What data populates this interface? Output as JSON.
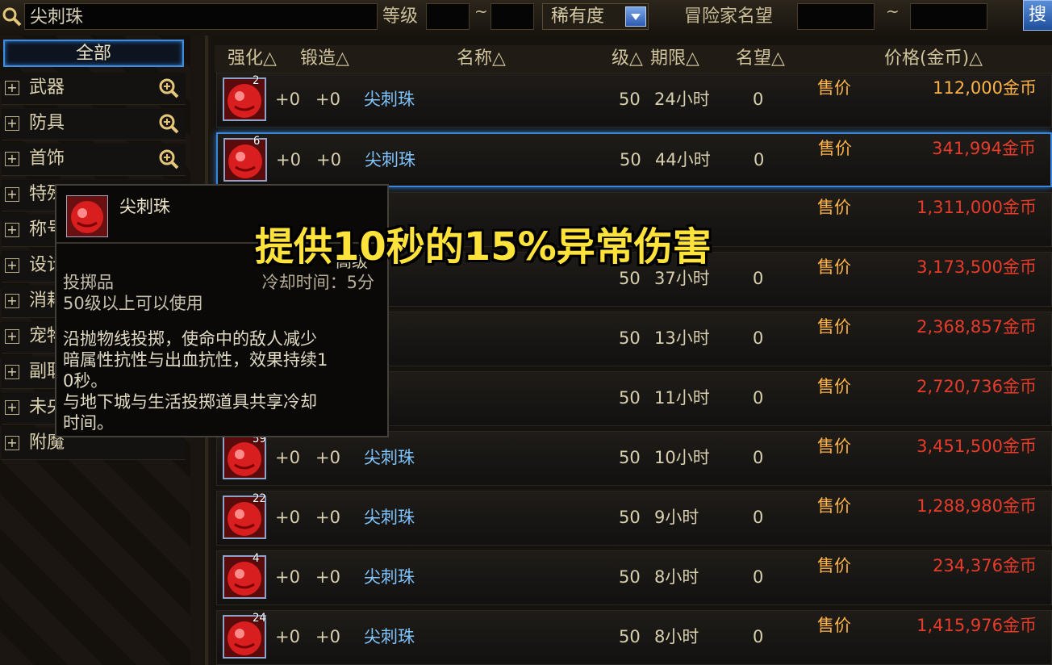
{
  "search": {
    "query": "尖刺珠"
  },
  "filters": {
    "level_label": "等级",
    "tilde": "~",
    "rarity_label": "稀有度",
    "fame_label": "冒险家名望",
    "search_button": "搜"
  },
  "sidebar": {
    "all_label": "全部",
    "categories": [
      {
        "label": "武器",
        "zoom": true
      },
      {
        "label": "防具",
        "zoom": true
      },
      {
        "label": "首饰",
        "zoom": true
      },
      {
        "label": "特殊装备",
        "zoom": false
      },
      {
        "label": "称号",
        "zoom": false
      },
      {
        "label": "设计图",
        "zoom": false
      },
      {
        "label": "消耗品",
        "zoom": false
      },
      {
        "label": "宠物",
        "zoom": false
      },
      {
        "label": "副职业",
        "zoom": false
      },
      {
        "label": "未央",
        "zoom": false
      },
      {
        "label": "附魔",
        "zoom": false
      }
    ]
  },
  "table": {
    "headers": [
      "强化△",
      "锻造△",
      "名称△",
      "级△",
      "期限△",
      "名望△",
      "价格(金币)△"
    ],
    "sell_label": "售价",
    "rows": [
      {
        "stack": "2",
        "enhance": "+0",
        "forge": "+0",
        "name": "尖刺珠",
        "level": "50",
        "period": "24小时",
        "fame": "0",
        "price": "112,000金币",
        "red": false,
        "selected": false
      },
      {
        "stack": "6",
        "enhance": "+0",
        "forge": "+0",
        "name": "尖刺珠",
        "level": "50",
        "period": "44小时",
        "fame": "0",
        "price": "341,994金币",
        "red": true,
        "selected": true
      },
      {
        "stack": "",
        "enhance": "",
        "forge": "",
        "name": "",
        "level": "",
        "period": "",
        "fame": "",
        "price": "1,311,000金币",
        "red": true,
        "selected": false
      },
      {
        "stack": "",
        "enhance": "",
        "forge": "",
        "name": "",
        "level": "50",
        "period": "37小时",
        "fame": "0",
        "price": "3,173,500金币",
        "red": true,
        "selected": false
      },
      {
        "stack": "",
        "enhance": "",
        "forge": "",
        "name": "",
        "level": "50",
        "period": "13小时",
        "fame": "0",
        "price": "2,368,857金币",
        "red": true,
        "selected": false
      },
      {
        "stack": "",
        "enhance": "",
        "forge": "",
        "name": "",
        "level": "50",
        "period": "11小时",
        "fame": "0",
        "price": "2,720,736金币",
        "red": true,
        "selected": false
      },
      {
        "stack": "59",
        "enhance": "+0",
        "forge": "+0",
        "name": "尖刺珠",
        "level": "50",
        "period": "10小时",
        "fame": "0",
        "price": "3,451,500金币",
        "red": true,
        "selected": false
      },
      {
        "stack": "22",
        "enhance": "+0",
        "forge": "+0",
        "name": "尖刺珠",
        "level": "50",
        "period": "9小时",
        "fame": "0",
        "price": "1,288,980金币",
        "red": true,
        "selected": false
      },
      {
        "stack": "4",
        "enhance": "+0",
        "forge": "+0",
        "name": "尖刺珠",
        "level": "50",
        "period": "8小时",
        "fame": "0",
        "price": "234,376金币",
        "red": true,
        "selected": false
      },
      {
        "stack": "24",
        "enhance": "+0",
        "forge": "+0",
        "name": "尖刺珠",
        "level": "50",
        "period": "8小时",
        "fame": "0",
        "price": "1,415,976金币",
        "red": true,
        "selected": false
      }
    ]
  },
  "tooltip": {
    "title": "尖刺珠",
    "cooldown": "冷却时间：5分",
    "type": "投掷品",
    "level_req": "50级以上可以使用",
    "desc_lines": [
      "沿抛物线投掷，使命中的敌人减少",
      "暗属性抗性与出血抗性，效果持续1",
      "0秒。",
      "与地下城与生活投掷道具共享冷却",
      "时间。"
    ]
  },
  "overlap_text": "高级",
  "banner": "提供10秒的15%异常伤害",
  "colors": {
    "accent": "#3b86d8",
    "price_orange": "#ffb347",
    "price_red": "#e83b2a",
    "banner_yellow": "#ffe23a"
  }
}
